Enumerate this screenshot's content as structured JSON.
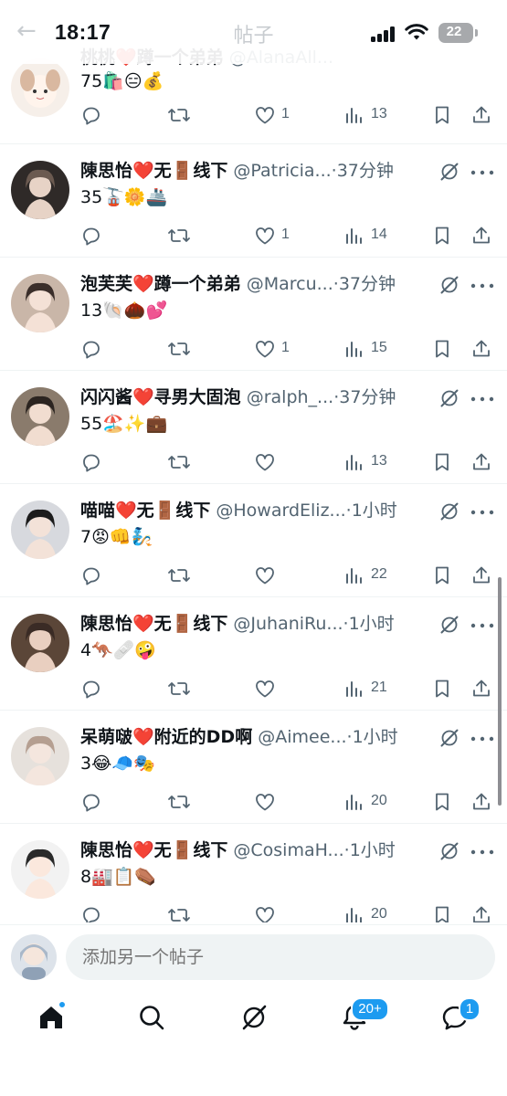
{
  "status_bar": {
    "time": "18:17",
    "battery": "22"
  },
  "nav": {
    "back_icon": "arrow-left-icon",
    "title": "帖子"
  },
  "top_partial_post": {
    "name": "桃桃❤️蹲一个弟弟",
    "handle": "@AlanaAll...",
    "time": "37分钟",
    "text": "75🛍️😑💰",
    "views": "13",
    "likes": "1"
  },
  "posts": [
    {
      "name": "陳思怡❤️无🚪线下",
      "handle": "@Patricia...",
      "time": "37分钟",
      "text": "35🚡🌼🚢",
      "likes": "1",
      "views": "14"
    },
    {
      "name": "泡芙芙❤️蹲一个弟弟",
      "handle": "@Marcu...",
      "time": "37分钟",
      "text": "13🐚🌰💕",
      "likes": "1",
      "views": "15"
    },
    {
      "name": "闪闪酱❤️寻男大固泡",
      "handle": "@ralph_...",
      "time": "37分钟",
      "text": "55🏖️✨💼",
      "likes": "",
      "views": "13"
    },
    {
      "name": "喵喵❤️无🚪线下",
      "handle": "@HowardEliz...",
      "time": "1小时",
      "text": "7😡👊🧞",
      "likes": "",
      "views": "22"
    },
    {
      "name": "陳思怡❤️无🚪线下",
      "handle": "@JuhaniRu...",
      "time": "1小时",
      "text": "4🦘🩹🤪",
      "likes": "",
      "views": "21"
    },
    {
      "name": "呆萌啵❤️附近的DD啊",
      "handle": "@Aimee...",
      "time": "1小时",
      "text": "3😂🧢🎭",
      "likes": "",
      "views": "20"
    },
    {
      "name": "陳思怡❤️无🚪线下",
      "handle": "@CosimaH...",
      "time": "1小时",
      "text": "8🏭📋⚰️",
      "likes": "",
      "views": "20"
    }
  ],
  "composer": {
    "placeholder": "添加另一个帖子"
  },
  "bottom_nav": {
    "notifications_badge": "20+",
    "messages_badge": "1"
  },
  "colors": {
    "accent": "#1d9bf0",
    "text": "#0f1419",
    "secondary": "#536471",
    "divider": "#eff3f4"
  }
}
